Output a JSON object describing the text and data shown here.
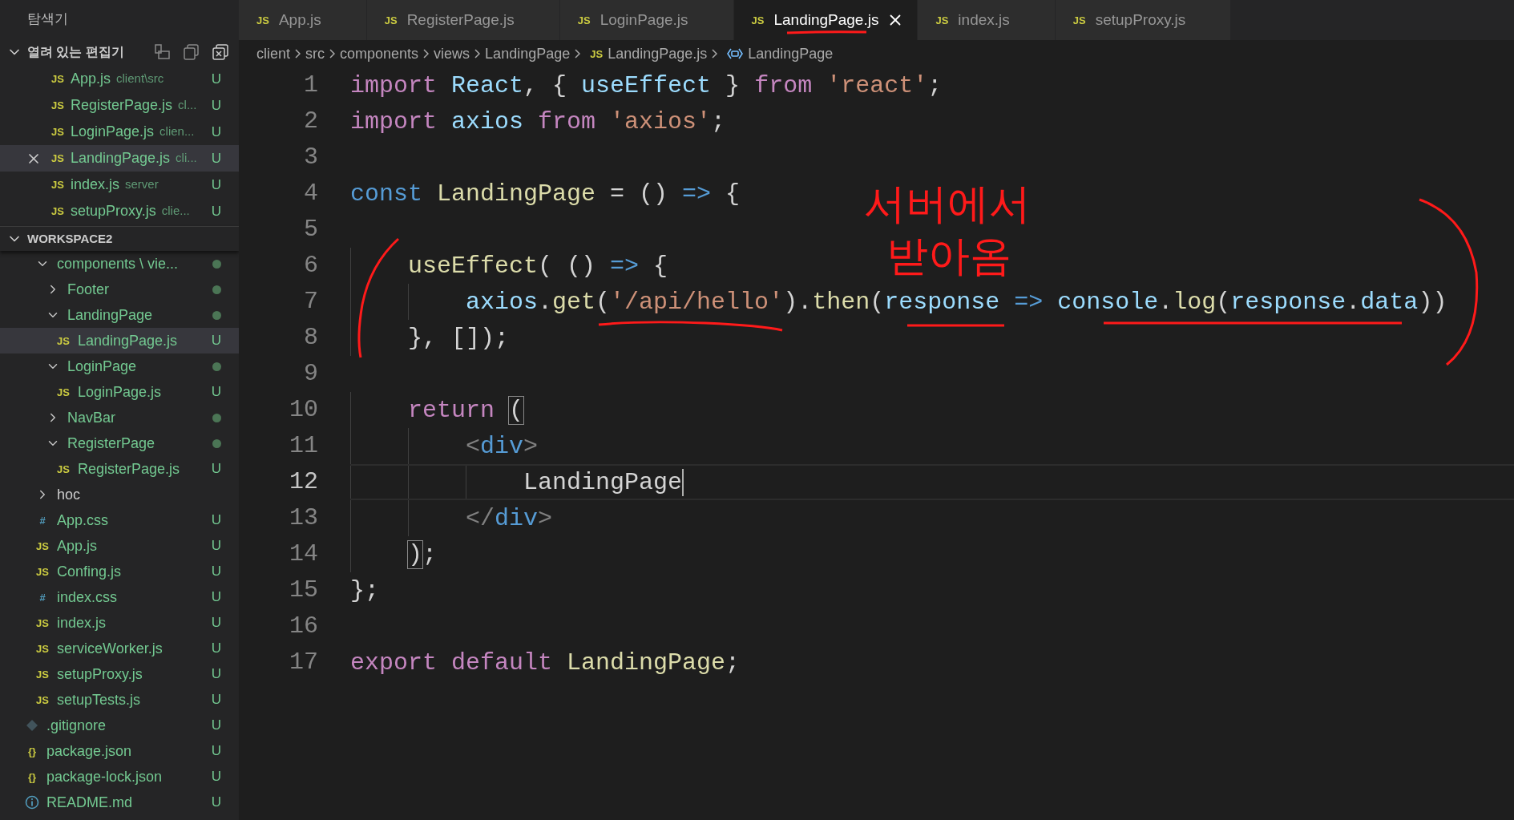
{
  "explorer": {
    "title": "탐색기",
    "open_editors": {
      "title": "열려 있는 편집기",
      "expanded": true,
      "items": [
        {
          "icon": "JS",
          "name": "App.js",
          "description": "client\\src",
          "status": "U",
          "selected": false
        },
        {
          "icon": "JS",
          "name": "RegisterPage.js",
          "description": "cl...",
          "status": "U",
          "selected": false
        },
        {
          "icon": "JS",
          "name": "LoginPage.js",
          "description": "clien...",
          "status": "U",
          "selected": false
        },
        {
          "icon": "JS",
          "name": "LandingPage.js",
          "description": "cli...",
          "status": "U",
          "selected": true
        },
        {
          "icon": "JS",
          "name": "index.js",
          "description": "server",
          "status": "U",
          "selected": false
        },
        {
          "icon": "JS",
          "name": "setupProxy.js",
          "description": "clie...",
          "status": "U",
          "selected": false
        }
      ]
    },
    "workspace": {
      "title": "WORKSPACE2",
      "expanded": true,
      "tree": [
        {
          "kind": "group",
          "children": [
            {
              "kind": "folder",
              "name": "components \\ vie...",
              "expanded": true,
              "dot": true,
              "children": [
                {
                  "kind": "folder",
                  "name": "Footer",
                  "expanded": false,
                  "dot": true
                },
                {
                  "kind": "folder",
                  "name": "LandingPage",
                  "expanded": true,
                  "dot": true,
                  "children": [
                    {
                      "kind": "js",
                      "icon": "JS",
                      "name": "LandingPage.js",
                      "status": "U",
                      "selected": true
                    }
                  ]
                },
                {
                  "kind": "folder",
                  "name": "LoginPage",
                  "expanded": true,
                  "dot": true,
                  "children": [
                    {
                      "kind": "js",
                      "icon": "JS",
                      "name": "LoginPage.js",
                      "status": "U",
                      "selected": false
                    }
                  ]
                },
                {
                  "kind": "folder",
                  "name": "NavBar",
                  "expanded": false,
                  "dot": true
                },
                {
                  "kind": "folder",
                  "name": "RegisterPage",
                  "expanded": true,
                  "dot": true,
                  "children": [
                    {
                      "kind": "js",
                      "icon": "JS",
                      "name": "RegisterPage.js",
                      "status": "U",
                      "selected": false
                    }
                  ]
                }
              ]
            },
            {
              "kind": "folder",
              "name": "hoc",
              "expanded": false,
              "dot": false
            },
            {
              "kind": "css",
              "icon": "#",
              "name": "App.css",
              "status": "U",
              "selected": false
            },
            {
              "kind": "js",
              "icon": "JS",
              "name": "App.js",
              "status": "U",
              "selected": false
            },
            {
              "kind": "js",
              "icon": "JS",
              "name": "Confing.js",
              "status": "U",
              "selected": false
            },
            {
              "kind": "css",
              "icon": "#",
              "name": "index.css",
              "status": "U",
              "selected": false
            },
            {
              "kind": "js",
              "icon": "JS",
              "name": "index.js",
              "status": "U",
              "selected": false
            },
            {
              "kind": "js",
              "icon": "JS",
              "name": "serviceWorker.js",
              "status": "U",
              "selected": false
            },
            {
              "kind": "js",
              "icon": "JS",
              "name": "setupProxy.js",
              "status": "U",
              "selected": false
            },
            {
              "kind": "js",
              "icon": "JS",
              "name": "setupTests.js",
              "status": "U",
              "selected": false
            }
          ]
        },
        {
          "kind": "git",
          "name": ".gitignore",
          "status": "U",
          "selected": false
        },
        {
          "kind": "json",
          "icon": "{}",
          "name": "package.json",
          "status": "U",
          "selected": false
        },
        {
          "kind": "json",
          "icon": "{}",
          "name": "package-lock.json",
          "status": "U",
          "selected": false
        },
        {
          "kind": "info",
          "name": "README.md",
          "status": "U",
          "selected": false
        }
      ]
    }
  },
  "tabs": [
    {
      "icon": "JS",
      "label": "App.js",
      "selected": false
    },
    {
      "icon": "JS",
      "label": "RegisterPage.js",
      "selected": false
    },
    {
      "icon": "JS",
      "label": "LoginPage.js",
      "selected": false
    },
    {
      "icon": "JS",
      "label": "LandingPage.js",
      "selected": true
    },
    {
      "icon": "JS",
      "label": "index.js",
      "selected": false
    },
    {
      "icon": "JS",
      "label": "setupProxy.js",
      "selected": false
    }
  ],
  "breadcrumbs": [
    {
      "kind": "folder",
      "text": "client"
    },
    {
      "kind": "folder",
      "text": "src"
    },
    {
      "kind": "folder",
      "text": "components"
    },
    {
      "kind": "folder",
      "text": "views"
    },
    {
      "kind": "folder",
      "text": "LandingPage"
    },
    {
      "kind": "file",
      "icon": "JS",
      "text": "LandingPage.js"
    },
    {
      "kind": "symbol",
      "text": "LandingPage"
    }
  ],
  "code": {
    "lines": [
      {
        "number": "1",
        "tokens": [
          {
            "kind": "kw",
            "text": "import"
          },
          {
            "kind": "var",
            "text": " React"
          },
          {
            "kind": "p",
            "text": ", { "
          },
          {
            "kind": "var",
            "text": "useEffect"
          },
          {
            "kind": "p",
            "text": " } "
          },
          {
            "kind": "kw",
            "text": "from"
          },
          {
            "kind": "str",
            "text": " 'react'"
          },
          {
            "kind": "p",
            "text": ";"
          }
        ]
      },
      {
        "number": "2",
        "tokens": [
          {
            "kind": "kw",
            "text": "import"
          },
          {
            "kind": "var",
            "text": " axios"
          },
          {
            "kind": "kw",
            "text": " from"
          },
          {
            "kind": "str",
            "text": " 'axios'"
          },
          {
            "kind": "p",
            "text": ";"
          }
        ]
      },
      {
        "number": "3"
      },
      {
        "number": "4",
        "tokens": [
          {
            "kind": "decl",
            "text": "const"
          },
          {
            "kind": "fn",
            "text": " LandingPage"
          },
          {
            "kind": "p",
            "text": " = () "
          },
          {
            "kind": "decl",
            "text": "=>"
          },
          {
            "kind": "p",
            "text": " {"
          }
        ]
      },
      {
        "number": "5"
      },
      {
        "number": "6",
        "tokens": [
          {
            "kind": "fn",
            "text": "    useEffect"
          },
          {
            "kind": "p",
            "text": "( () "
          },
          {
            "kind": "decl",
            "text": "=>"
          },
          {
            "kind": "p",
            "text": " {"
          }
        ]
      },
      {
        "number": "7",
        "tokens": [
          {
            "kind": "var",
            "text": "        axios"
          },
          {
            "kind": "p",
            "text": "."
          },
          {
            "kind": "fn",
            "text": "get"
          },
          {
            "kind": "p",
            "text": "("
          },
          {
            "kind": "str",
            "text": "'/api/hello'"
          },
          {
            "kind": "p",
            "text": ")."
          },
          {
            "kind": "fn",
            "text": "then"
          },
          {
            "kind": "p",
            "text": "("
          },
          {
            "kind": "var",
            "text": "response"
          },
          {
            "kind": "decl",
            "text": " =>"
          },
          {
            "kind": "var",
            "text": " console"
          },
          {
            "kind": "p",
            "text": "."
          },
          {
            "kind": "fn",
            "text": "log"
          },
          {
            "kind": "p",
            "text": "("
          },
          {
            "kind": "var",
            "text": "response"
          },
          {
            "kind": "p",
            "text": "."
          },
          {
            "kind": "var",
            "text": "data"
          },
          {
            "kind": "p",
            "text": "))"
          }
        ]
      },
      {
        "number": "8",
        "tokens": [
          {
            "kind": "p",
            "text": "    }, []);"
          }
        ]
      },
      {
        "number": "9"
      },
      {
        "number": "10",
        "tokens": [
          {
            "kind": "kw",
            "text": "    return "
          },
          {
            "kind": "match",
            "text": "("
          }
        ]
      },
      {
        "number": "11",
        "tokens": [
          {
            "kind": "tagp",
            "text": "        <"
          },
          {
            "kind": "decl",
            "text": "div"
          },
          {
            "kind": "tagp",
            "text": ">"
          }
        ]
      },
      {
        "number": "12",
        "current": true,
        "tokens": [
          {
            "kind": "p",
            "text": "            LandingPage"
          }
        ]
      },
      {
        "number": "13",
        "tokens": [
          {
            "kind": "tagp",
            "text": "        </"
          },
          {
            "kind": "decl",
            "text": "div"
          },
          {
            "kind": "tagp",
            "text": ">"
          }
        ]
      },
      {
        "number": "14",
        "tokens": [
          {
            "kind": "match",
            "text": "    )"
          },
          {
            "kind": "p",
            "text": ";"
          }
        ]
      },
      {
        "number": "15",
        "tokens": [
          {
            "kind": "p",
            "text": "};"
          }
        ]
      },
      {
        "number": "16"
      },
      {
        "number": "17",
        "tokens": [
          {
            "kind": "kw",
            "text": "export"
          },
          {
            "kind": "kw",
            "text": " default"
          },
          {
            "kind": "fn",
            "text": " LandingPage"
          },
          {
            "kind": "p",
            "text": ";"
          }
        ]
      }
    ]
  },
  "annotation": {
    "lines": [
      "서버에서",
      "받아옴"
    ]
  }
}
